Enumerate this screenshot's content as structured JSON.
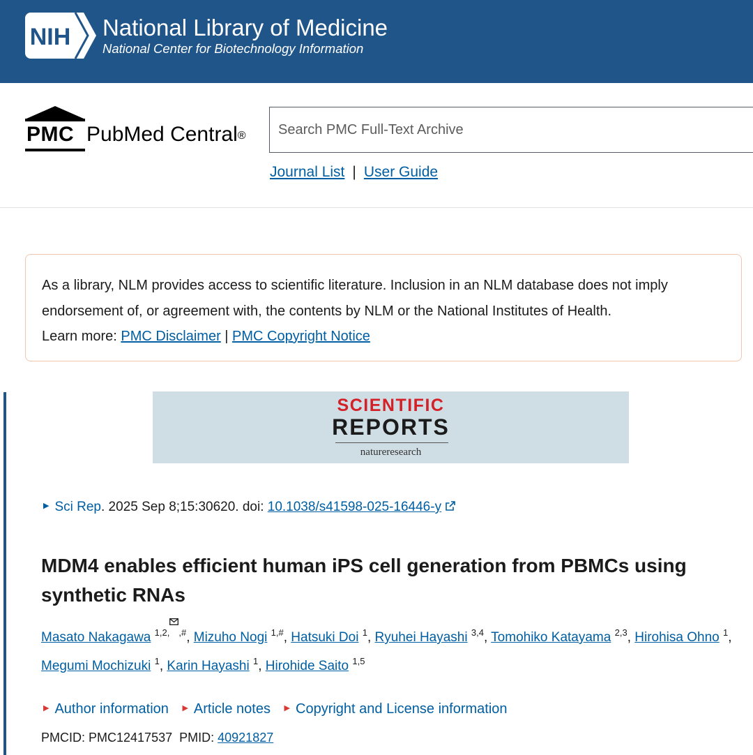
{
  "nih": {
    "logo_text": "NIH",
    "title": "National Library of Medicine",
    "subtitle": "National Center for Biotechnology Information"
  },
  "pmc": {
    "abbr": "PMC",
    "name": "PubMed Central",
    "registered": "®"
  },
  "search": {
    "placeholder": "Search PMC Full-Text Archive",
    "value": ""
  },
  "header_links": {
    "journal_list": "Journal List",
    "separator": "|",
    "user_guide": "User Guide"
  },
  "disclaimer": {
    "line1": "As a library, NLM provides access to scientific literature. Inclusion in an NLM database does not imply",
    "line2": "endorsement of, or agreement with, the contents by NLM or the National Institutes of Health.",
    "learn_more": "Learn more: ",
    "disclaimer_link": "PMC Disclaimer",
    "separator": " | ",
    "copyright_link": "PMC Copyright Notice"
  },
  "journal_banner": {
    "line1": "SCIENTIFIC",
    "line2": "REPORTS",
    "publisher": "natureresearch"
  },
  "citation": {
    "journal": "Sci Rep",
    "details": ". 2025 Sep 8;15:30620. doi: ",
    "doi": "10.1038/s41598-025-16446-y"
  },
  "article": {
    "title": "MDM4 enables efficient human iPS cell generation from PBMCs using synthetic RNAs"
  },
  "authors": [
    {
      "name": "Masato Nakagawa",
      "sup_pre": "1,2,",
      "mail": true,
      "sup_post": ",#",
      "sep": ", "
    },
    {
      "name": "Mizuho Nogi",
      "sup_pre": "1,#",
      "mail": false,
      "sup_post": "",
      "sep": ", "
    },
    {
      "name": "Hatsuki Doi",
      "sup_pre": "1",
      "mail": false,
      "sup_post": "",
      "sep": ", "
    },
    {
      "name": "Ryuhei Hayashi",
      "sup_pre": "3,4",
      "mail": false,
      "sup_post": "",
      "sep": ", "
    },
    {
      "name": "Tomohiko Katayama",
      "sup_pre": "2,3",
      "mail": false,
      "sup_post": "",
      "sep": ", "
    },
    {
      "name": "Hirohisa Ohno",
      "sup_pre": "1",
      "mail": false,
      "sup_post": "",
      "sep": ", "
    },
    {
      "name": "Megumi Mochizuki",
      "sup_pre": "1",
      "mail": false,
      "sup_post": "",
      "sep": ", "
    },
    {
      "name": "Karin Hayashi",
      "sup_pre": "1",
      "mail": false,
      "sup_post": "",
      "sep": ", "
    },
    {
      "name": "Hirohide Saito",
      "sup_pre": "1,5",
      "mail": false,
      "sup_post": "",
      "sep": ""
    }
  ],
  "meta_links": {
    "author_info": "Author information",
    "article_notes": "Article notes",
    "copyright": "Copyright and License information"
  },
  "ids": {
    "pmcid_label": "PMCID: ",
    "pmcid": "PMC12417537",
    "pmid_label": "PMID: ",
    "pmid": "40921827"
  },
  "colors": {
    "nih_blue": "#20558a",
    "link_blue": "#005ea2",
    "red_triangle": "#d83933",
    "banner_bg": "#cfdee5"
  }
}
